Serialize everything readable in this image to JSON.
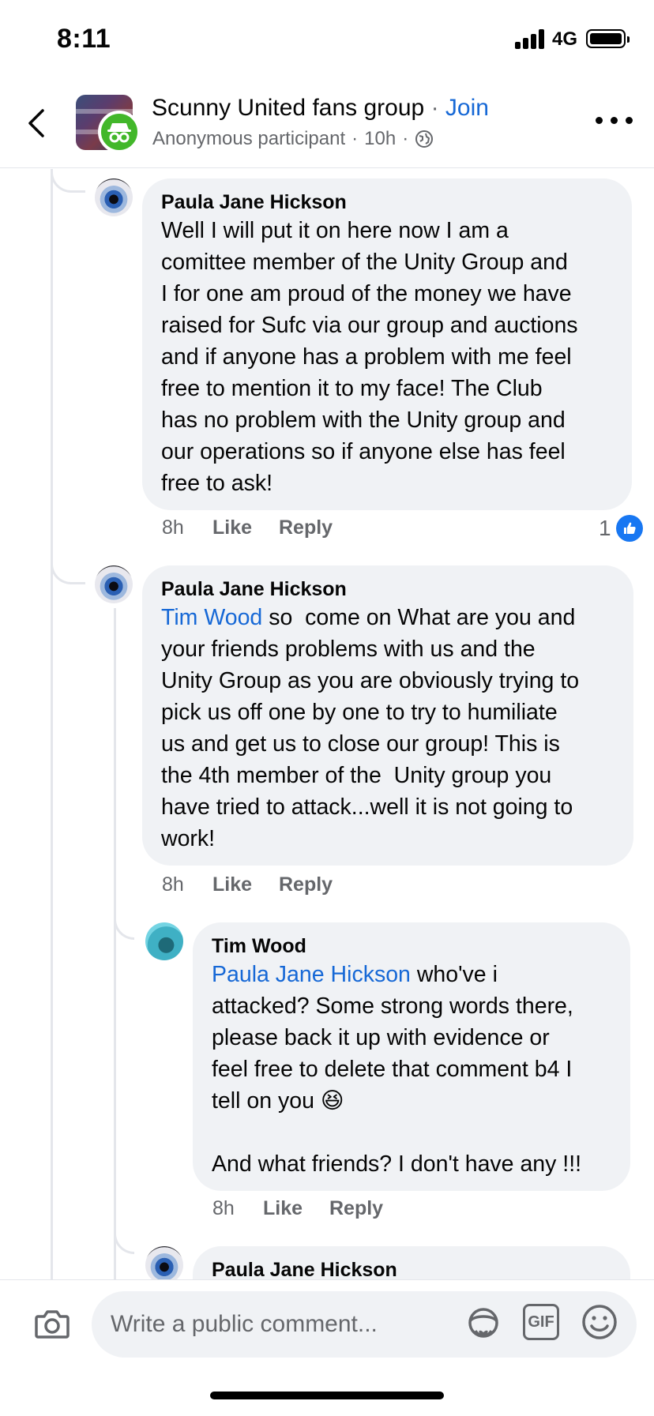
{
  "status_bar": {
    "time": "8:11",
    "network": "4G"
  },
  "header": {
    "group_name": "Scunny United fans group",
    "separator": "·",
    "join_label": "Join",
    "participant": "Anonymous participant",
    "time_ago": "10h",
    "sub_separator": "·",
    "privacy_icon": "globe-icon"
  },
  "comments": [
    {
      "author": "Paula Jane Hickson",
      "mention": "",
      "text": "Well I will put it on here now I am a\ncomittee member of the Unity Group and\nI for one am proud of the money we have\nraised for Sufc via our group and auctions\nand if anyone has a problem with me feel\nfree to mention it to my face! The Club\nhas no problem with the Unity group and\nour operations so if anyone else has feel\nfree to ask!",
      "time": "8h",
      "like_label": "Like",
      "reply_label": "Reply",
      "reaction_count": "1"
    },
    {
      "author": "Paula Jane Hickson",
      "mention": "Tim Wood",
      "text": " so  come on What are you and\nyour friends problems with us and the\nUnity Group as you are obviously trying to\npick us off one by one to try to humiliate\nus and get us to close our group! This is\nthe 4th member of the  Unity group you\nhave tried to attack...well it is not going to\nwork!",
      "time": "8h",
      "like_label": "Like",
      "reply_label": "Reply"
    },
    {
      "author": "Tim Wood",
      "mention": "Paula Jane Hickson",
      "text": " who've i\nattacked? Some strong words there,\nplease back it up with evidence or\nfeel free to delete that comment b4 I\ntell on you 😆\n\nAnd what friends? I don't have any !!!",
      "time": "8h",
      "like_label": "Like",
      "reply_label": "Reply"
    },
    {
      "author": "Paula Jane Hickson"
    }
  ],
  "composer": {
    "placeholder": "Write a public comment...",
    "gif_label": "GIF"
  },
  "colors": {
    "link": "#1668d6",
    "like_blue": "#1877f2",
    "bubble": "#f0f2f5",
    "muted": "#65676b"
  }
}
